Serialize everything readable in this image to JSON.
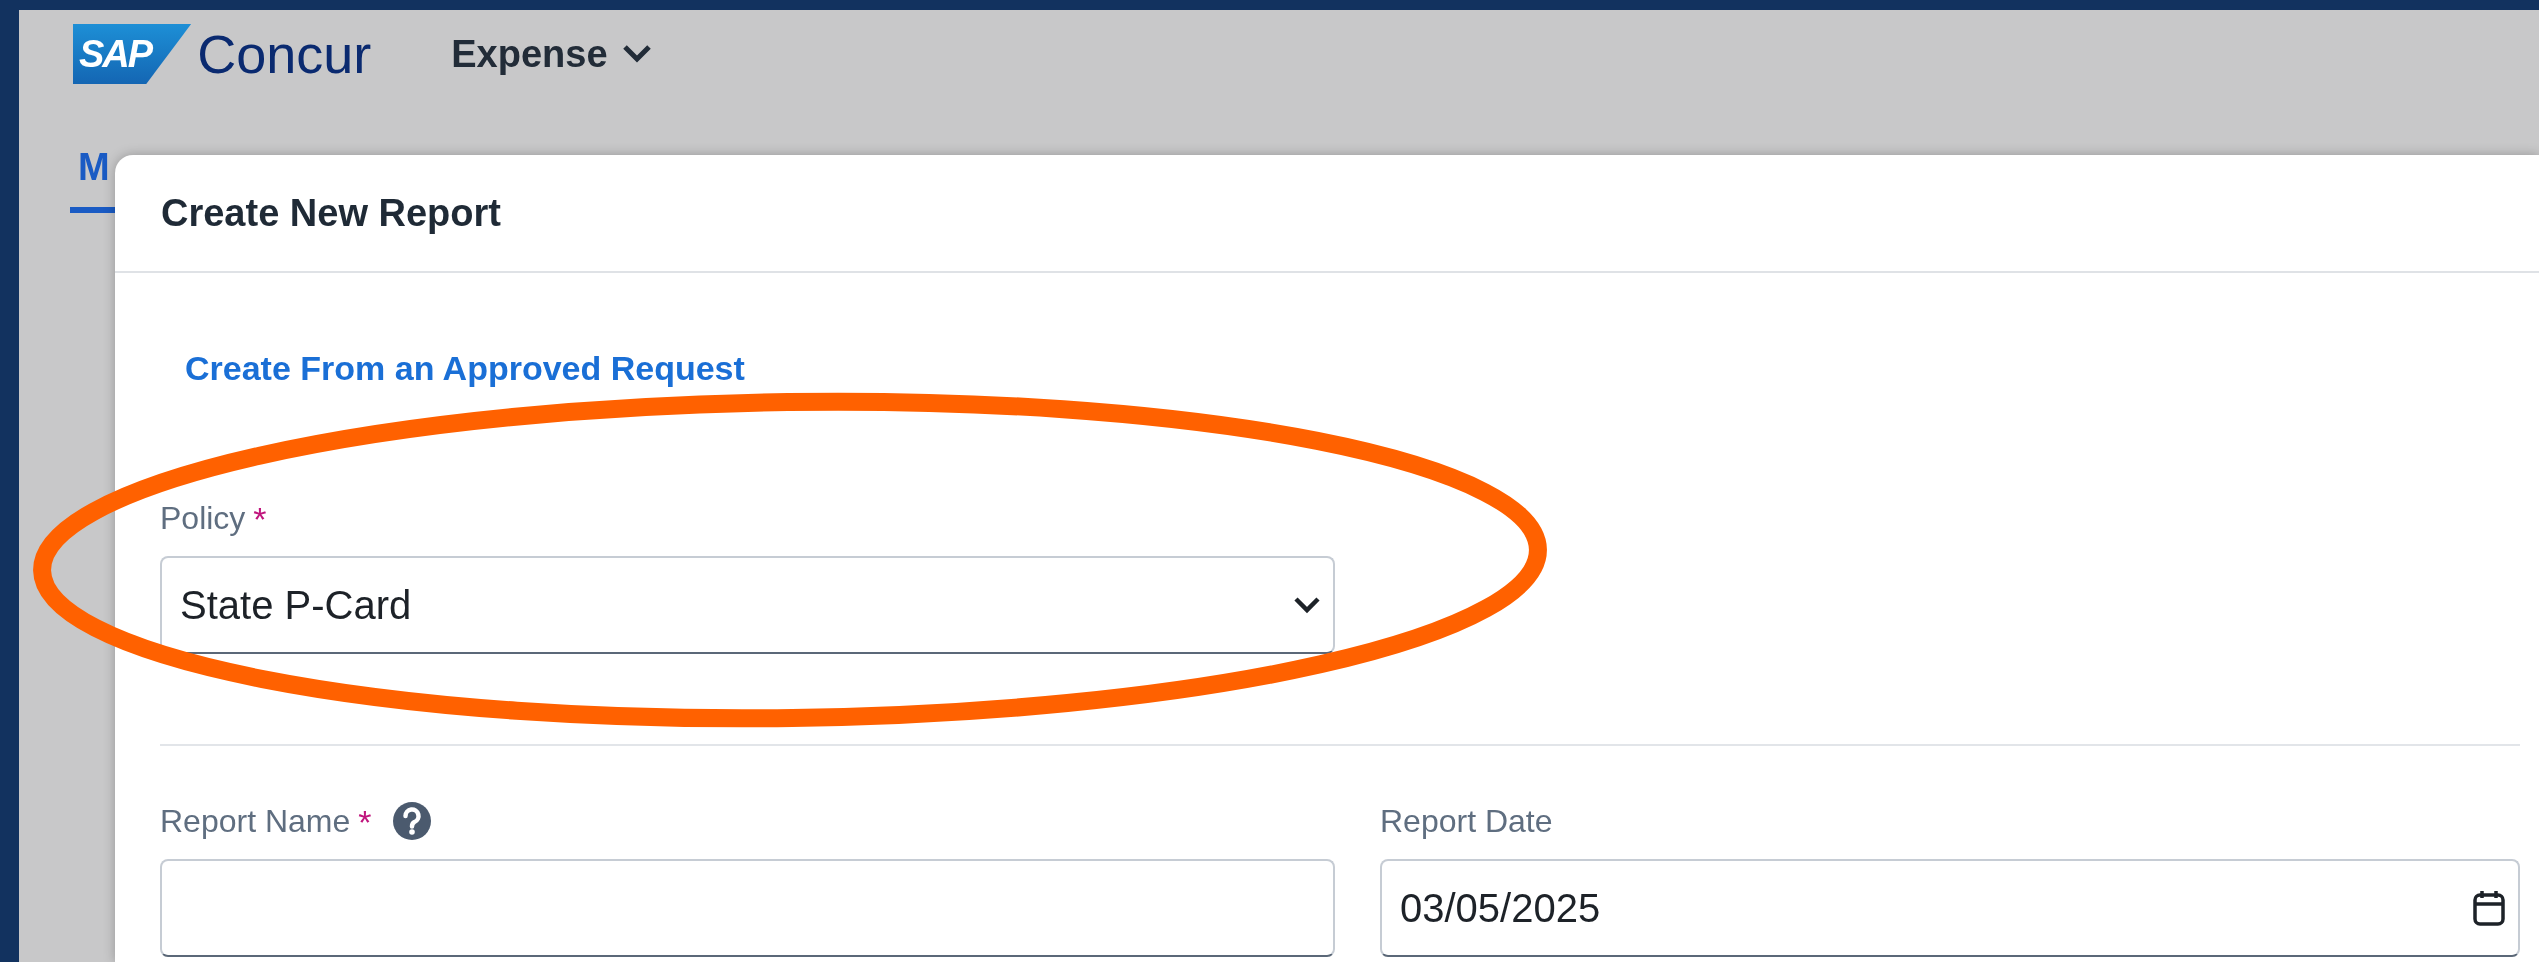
{
  "app_header": {
    "logo_mark": "SAP",
    "logo_name": "Concur",
    "product_menu": "Expense"
  },
  "tabs": [
    {
      "label": "M",
      "selected": true
    }
  ],
  "dialog": {
    "title": "Create New Report",
    "link": "Create From an Approved Request",
    "sections": [
      {
        "fields": [
          {
            "kind": "select",
            "label": "Policy",
            "required_mark": "*",
            "help": false,
            "value": "State P-Card"
          }
        ]
      },
      {
        "fields": [
          {
            "kind": "text",
            "label": "Report Name",
            "required_mark": "*",
            "help": true
          },
          {
            "kind": "date",
            "label": "Report Date",
            "help": false,
            "value": "03/05/2025"
          }
        ]
      }
    ]
  },
  "annotation": {
    "kind": "ellipse"
  }
}
